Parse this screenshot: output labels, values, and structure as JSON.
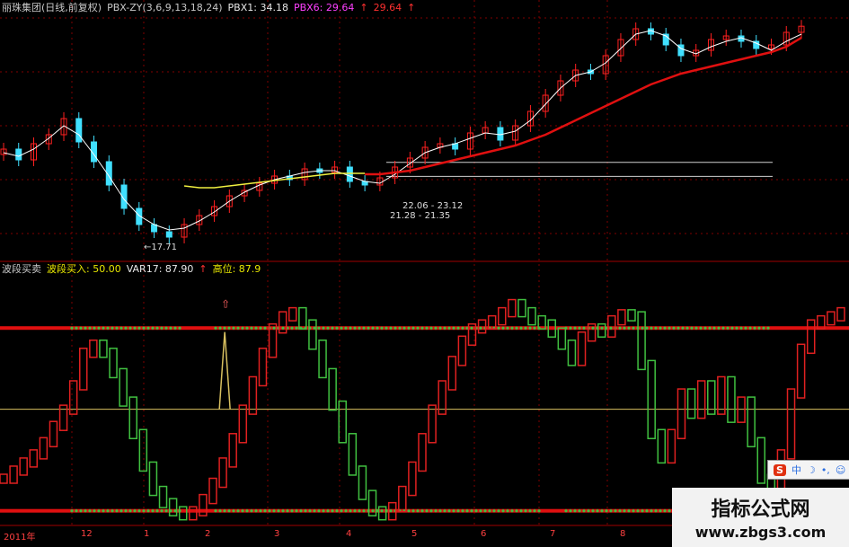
{
  "top_header": {
    "stock": "丽珠集团(日线,前复权)",
    "indicator": "PBX-ZY(3,6,9,13,18,24)",
    "pbx1": "PBX1: 34.18",
    "pbx6": "PBX6: 29.64",
    "extra": "29.64",
    "arrow": "↑"
  },
  "bottom_header": {
    "name": "波段买卖",
    "buy": "波段买入: 50.00",
    "var17": "VAR17: 87.90",
    "high": "高位: 87.9",
    "arrow": "↑"
  },
  "annotations": {
    "low_price": "←17.71",
    "range1": "22.06 - 23.12",
    "range2": "21.28 - 21.35"
  },
  "x_axis": {
    "year": "2011年",
    "ticks": [
      "12",
      "1",
      "2",
      "3",
      "4",
      "5",
      "6",
      "7",
      "8"
    ]
  },
  "toolbar": {
    "s": "S",
    "zh": "中",
    "moon": "☽",
    "dot": "•,",
    "smile": "☺",
    "grid": "▦"
  },
  "watermark": {
    "title": "指标公式网",
    "url": "www.zbgs3.com"
  },
  "colors": {
    "up": "#ff2020",
    "down": "#40e0ff",
    "osc_up": "#e02020",
    "osc_down": "#40c040",
    "ma_white": "#ffffff",
    "ma_red": "#e01010",
    "ma_yellow": "#f0f040",
    "grid": "#800000"
  },
  "chart_data": [
    {
      "type": "candlestick",
      "series": [
        {
          "name": "PBX1",
          "values": [
            22.6,
            22.4,
            22.8,
            23.4,
            24.1,
            23.6,
            22.5,
            21.3,
            20.0,
            19.1,
            18.6,
            18.3,
            18.4,
            18.8,
            19.3,
            19.9,
            20.4,
            20.8,
            21.1,
            21.3,
            21.5,
            21.6,
            21.6,
            21.3,
            21.0,
            20.9,
            21.4,
            22.0,
            22.6,
            22.9,
            23.1,
            23.4,
            23.7,
            23.6,
            23.8,
            24.4,
            25.3,
            26.2,
            26.9,
            27.1,
            27.6,
            28.4,
            29.2,
            29.4,
            29.1,
            28.4,
            28.1,
            28.5,
            28.8,
            29.0,
            28.7,
            28.3,
            28.8,
            29.2
          ]
        },
        {
          "name": "PBX6",
          "values": [
            21.6,
            21.7,
            21.9,
            22.1,
            22.3,
            22.4,
            22.3,
            22.1,
            21.8,
            21.5,
            21.2,
            20.9,
            20.7,
            20.6,
            20.6,
            20.7,
            20.8,
            20.9,
            21.0,
            21.1,
            21.2,
            21.3,
            21.4,
            21.4,
            21.4,
            21.4,
            21.5,
            21.6,
            21.8,
            22.0,
            22.2,
            22.4,
            22.6,
            22.8,
            23.0,
            23.3,
            23.6,
            24.0,
            24.4,
            24.8,
            25.2,
            25.6,
            26.0,
            26.4,
            26.7,
            27.0,
            27.2,
            27.4,
            27.6,
            27.8,
            28.0,
            28.2,
            28.5,
            29.0
          ]
        }
      ],
      "closes": [
        22.8,
        22.2,
        23.1,
        23.6,
        24.5,
        23.2,
        22.1,
        20.8,
        19.5,
        18.6,
        18.2,
        17.9,
        18.6,
        19.1,
        19.6,
        20.2,
        20.5,
        20.9,
        21.3,
        21.1,
        21.7,
        21.5,
        21.8,
        21.0,
        20.8,
        21.2,
        21.8,
        22.3,
        22.9,
        23.1,
        22.8,
        23.7,
        24.0,
        23.3,
        24.1,
        24.9,
        25.8,
        26.6,
        27.2,
        27.0,
        28.0,
        28.9,
        29.5,
        29.2,
        28.6,
        28.0,
        28.3,
        28.9,
        29.1,
        28.8,
        28.4,
        28.6,
        29.3,
        29.64
      ],
      "ylim": [
        17.0,
        30.5
      ],
      "levels": [
        22.06,
        21.28
      ]
    },
    {
      "type": "oscillator",
      "name": "波段买卖",
      "values": [
        18,
        22,
        26,
        30,
        36,
        44,
        52,
        64,
        80,
        84,
        80,
        70,
        56,
        40,
        24,
        12,
        6,
        2,
        0,
        2,
        8,
        16,
        26,
        38,
        52,
        66,
        80,
        92,
        98,
        100,
        94,
        84,
        70,
        54,
        38,
        22,
        10,
        2,
        0,
        4,
        12,
        24,
        38,
        52,
        64,
        76,
        86,
        92,
        94,
        96,
        100,
        104,
        100,
        96,
        94,
        90,
        84,
        76,
        88,
        92,
        90,
        96,
        99,
        98,
        74,
        40,
        28,
        40,
        60,
        50,
        64,
        52,
        66,
        48,
        56,
        36,
        18,
        8,
        30,
        60,
        82,
        94,
        96,
        98,
        100
      ],
      "lines": [
        0,
        50,
        90
      ],
      "ylim": [
        -5,
        110
      ],
      "spike_at": 33
    }
  ]
}
